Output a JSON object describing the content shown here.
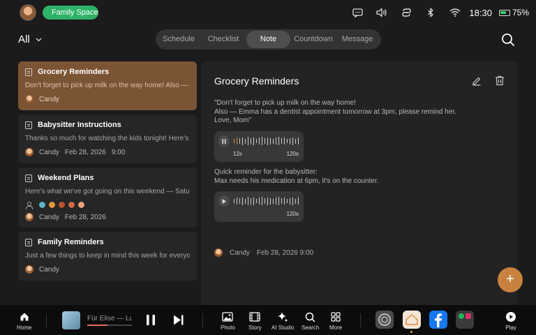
{
  "status": {
    "family_label": "Family Space",
    "time": "18:30",
    "battery": "75%",
    "battery_level": 0.75,
    "icons": [
      "message-icon",
      "volume-icon",
      "link-icon",
      "bluetooth-icon",
      "wifi-icon",
      "battery-icon"
    ]
  },
  "filter": {
    "label": "All"
  },
  "tabs": [
    "Schedule",
    "Checklist",
    "Note",
    "Countdown",
    "Message"
  ],
  "active_tab": "Note",
  "notes": [
    {
      "title": "Grocery Reminders",
      "preview": "Don't forget to pick up milk on the way home! Also — Emma has a dentist appointment",
      "author": "Candy",
      "date": "",
      "time": ""
    },
    {
      "title": "Babysitter Instructions",
      "preview": "Thanks so much for watching the kids tonight! Here's everything you need to know",
      "author": "Candy",
      "date": "Feb 28, 2026",
      "time": "9:00"
    },
    {
      "title": "Weekend Plans",
      "preview": "Here's what we've got going on this weekend — Saturday morning",
      "author": "Candy",
      "date": "Feb 28, 2026",
      "time": ""
    },
    {
      "title": "Family Reminders",
      "preview": "Just a few things to keep in mind this week for everyone...",
      "author": "Candy",
      "date": "",
      "time": ""
    }
  ],
  "detail": {
    "title": "Grocery Reminders",
    "line1": "\"Don't forget to pick up milk on the way home!",
    "line2": "Also — Emma has a dentist appointment  tomorrow at 3pm, please remind her.",
    "line3": "Love, Mom\"",
    "audio1": {
      "elapsed": "12s",
      "total": "120s",
      "state": "playing",
      "progress": 0.1
    },
    "line4": "Quick reminder for the babysitter:",
    "line5": "Max needs his medication at 6pm, it's on the counter.",
    "audio2": {
      "total": "120s",
      "state": "paused"
    },
    "author": "Candy",
    "datetime": "Feb 28, 2026 9:00"
  },
  "fab": "+",
  "dock": {
    "home": "Home",
    "track": "Für Elise — Ludwig van Beethoven",
    "track_progress": 0.45,
    "photo": "Photo",
    "story": "Story",
    "ai_studio": "AI Studio",
    "search": "Search",
    "more": "More",
    "play": "Play",
    "apps": [
      "settings-app",
      "home-app",
      "facebook-app",
      "spotify-instagram-folder"
    ]
  }
}
